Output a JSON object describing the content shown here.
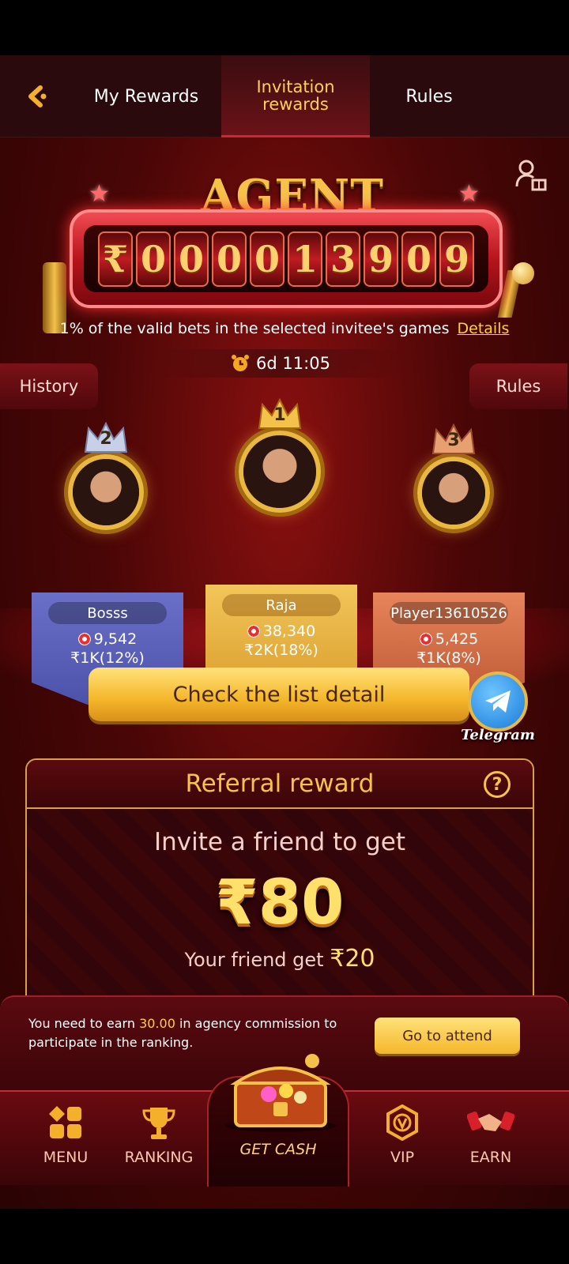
{
  "header": {
    "tabs": [
      {
        "label": "My Rewards"
      },
      {
        "label": "Invitation rewards"
      },
      {
        "label": "Rules"
      }
    ]
  },
  "jackpot": {
    "title": "AGENT JACKPOT",
    "currency": "₹",
    "digits": [
      "0",
      "0",
      "0",
      "0",
      "1",
      "3",
      "9",
      "0",
      "9"
    ],
    "description": "1% of the valid bets in the selected invitee's games",
    "details_link": "Details",
    "timer": "6d 11:05",
    "history_label": "History",
    "rules_label": "Rules"
  },
  "leaderboard": [
    {
      "rank": "2",
      "name": "Bosss",
      "score": "9,542",
      "reward": "₹1K(12%)"
    },
    {
      "rank": "1",
      "name": "Raja",
      "score": "38,340",
      "reward": "₹2K(18%)"
    },
    {
      "rank": "3",
      "name": "Player13610526",
      "score": "5,425",
      "reward": "₹1K(8%)"
    }
  ],
  "cta_label": "Check the list detail",
  "telegram_label": "Telegram",
  "referral": {
    "title": "Referral reward",
    "invite_text": "Invite a friend to get",
    "amount": "₹80",
    "friend_prefix": "Your friend get",
    "friend_amount": "₹20"
  },
  "notice": {
    "text_before": "You need to earn ",
    "highlight": "30.00",
    "text_after": " in agency commission to participate in the ranking.",
    "button": "Go to attend"
  },
  "nav": {
    "items": [
      {
        "label": "MENU",
        "icon": "menu-icon"
      },
      {
        "label": "RANKING",
        "icon": "trophy-icon"
      },
      {
        "label": "GET CASH",
        "icon": "treasure-chest-icon"
      },
      {
        "label": "VIP",
        "icon": "vip-badge-icon"
      },
      {
        "label": "EARN",
        "icon": "handshake-icon"
      }
    ]
  },
  "colors": {
    "gold": "#f6c24a",
    "deep_red": "#4a0606",
    "accent_red": "#c82a32"
  }
}
